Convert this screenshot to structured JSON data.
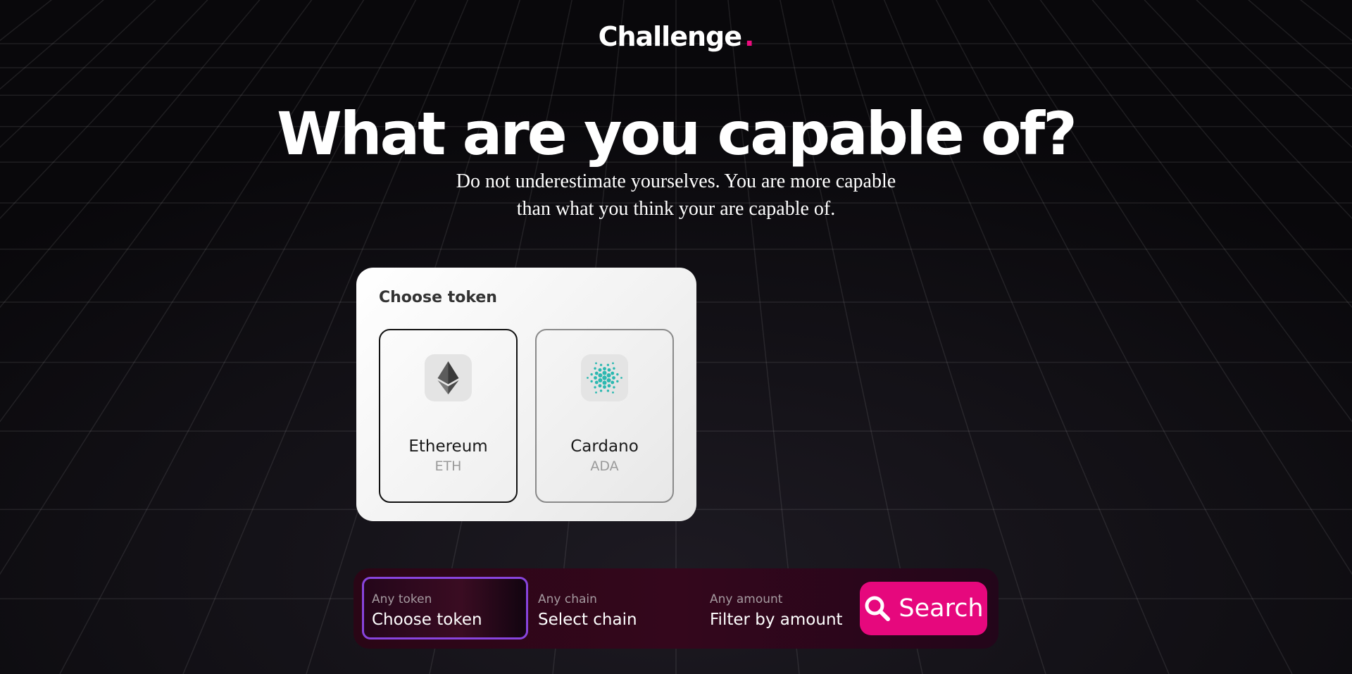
{
  "header": {
    "brand": "Challenge",
    "brand_dot": "."
  },
  "hero": {
    "title": "What are you capable of?",
    "subtitle_line1": "Do not underestimate yourselves. You are more capable",
    "subtitle_line2": "than what you think your are capable of."
  },
  "token_panel": {
    "heading": "Choose token",
    "tokens": [
      {
        "name": "Ethereum",
        "symbol": "ETH",
        "icon": "ethereum-icon",
        "selected": true
      },
      {
        "name": "Cardano",
        "symbol": "ADA",
        "icon": "cardano-icon",
        "selected": false
      }
    ]
  },
  "search_bar": {
    "token": {
      "label": "Any token",
      "value": "Choose token"
    },
    "chain": {
      "label": "Any chain",
      "value": "Select chain"
    },
    "amount": {
      "label": "Any amount",
      "value": "Filter by amount"
    },
    "button_label": "Search",
    "button_icon": "search-icon"
  },
  "colors": {
    "accent": "#e6087d",
    "background": "#0b0a0d",
    "focus_border": "#8844dd",
    "cardano": "#2bb8b0"
  }
}
